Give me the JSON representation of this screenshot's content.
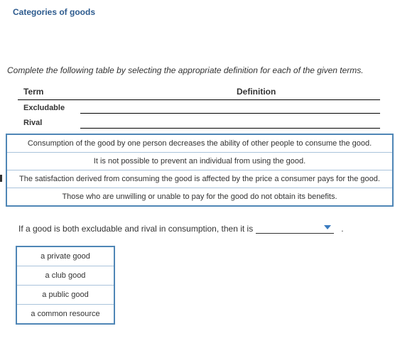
{
  "title": "Categories of goods",
  "instruction": "Complete the following table by selecting the appropriate definition for each of the given terms.",
  "table": {
    "headers": {
      "term": "Term",
      "definition": "Definition"
    },
    "rows": [
      {
        "term": "Excludable"
      },
      {
        "term": "Rival"
      }
    ]
  },
  "definition_options": [
    "Consumption of the good by one person decreases the ability of other people to consume the good.",
    "It is not possible to prevent an individual from using the good.",
    "The satisfaction derived from consuming the good is affected by the price a consumer pays for the good.",
    "Those who are unwilling or unable to pay for the good do not obtain its benefits."
  ],
  "sentence": {
    "prefix": "If a good is both excludable and rival in consumption, then it is",
    "selected": "",
    "suffix": "."
  },
  "good_type_options": [
    "a private good",
    "a club good",
    "a public good",
    "a common resource"
  ],
  "colors": {
    "title": "#2d5b8e",
    "panel_border": "#4f86b6",
    "panel_inner_border": "#a9c3db",
    "arrow": "#3a7bbf"
  }
}
